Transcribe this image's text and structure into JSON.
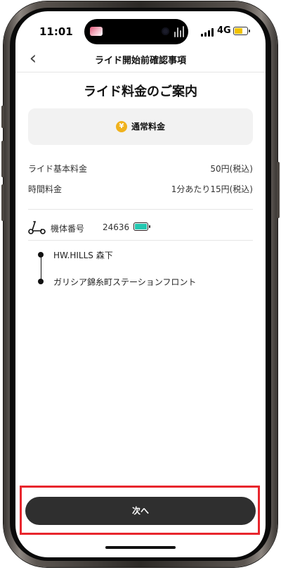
{
  "status_bar": {
    "time": "11:01",
    "network": "4G",
    "battery_level": 0.6,
    "icons": [
      "signal-icon",
      "battery-icon"
    ]
  },
  "nav": {
    "back_icon": "chevron-left-icon",
    "title": "ライド開始前確認事項"
  },
  "heading": "ライド料金のご案内",
  "plan": {
    "icon": "yen-coin-icon",
    "icon_glyph": "¥",
    "label": "通常料金"
  },
  "fees": [
    {
      "label": "ライド基本料金",
      "value": "50円(税込)"
    },
    {
      "label": "時間料金",
      "value": "1分あたり15円(税込)"
    }
  ],
  "vehicle": {
    "icon": "scooter-icon",
    "label": "機体番号",
    "number": "24636",
    "battery_icon": "battery-icon",
    "battery_color": "#22c7b0",
    "battery_level": 0.9
  },
  "route": {
    "start": "HW.HILLS 森下",
    "end": "ガリシア錦糸町ステーションフロント"
  },
  "next_button": {
    "label": "次へ"
  },
  "colors": {
    "accent_yellow": "#f0b21d",
    "button_bg": "#2f2f2f",
    "highlight_red": "#e8262d"
  }
}
